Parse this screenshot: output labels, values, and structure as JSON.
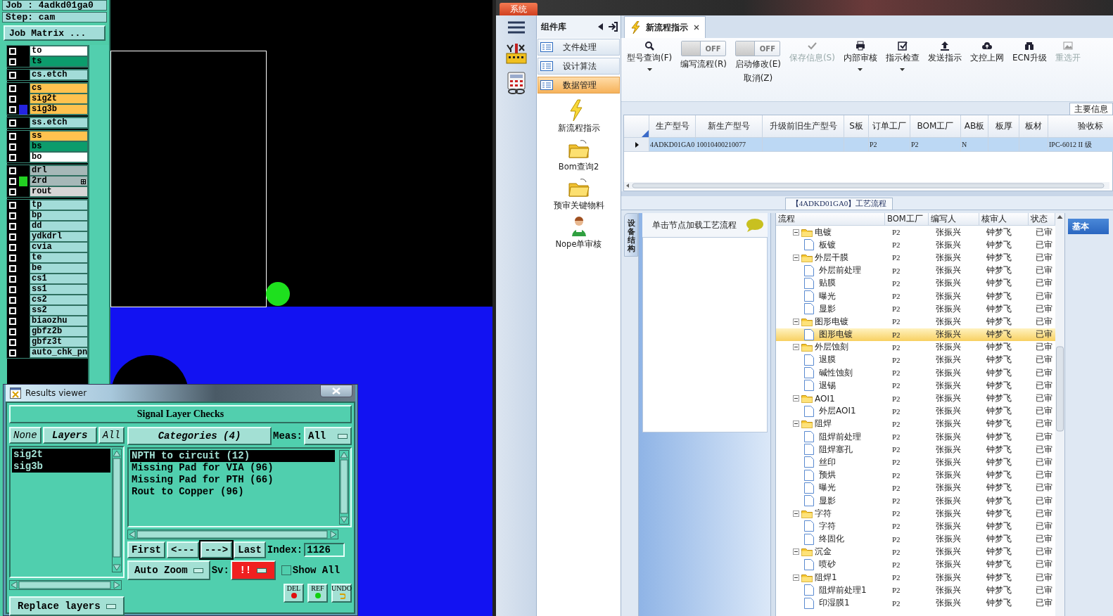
{
  "cam": {
    "job": "Job : 4adkd01ga0",
    "step": "Step: cam",
    "job_matrix_button": "Job Matrix ...",
    "layer_groups": [
      {
        "layers": [
          {
            "name": "to",
            "color": "#ffffff",
            "checked": false
          },
          {
            "name": "ts",
            "color": "#0c9c6c",
            "checked": false
          }
        ]
      },
      {
        "layers": [
          {
            "name": "cs.etch",
            "color": "#a2dcd8",
            "checked": false
          }
        ]
      },
      {
        "layers": [
          {
            "name": "cs",
            "color": "#ffc24f",
            "checked": false
          },
          {
            "name": "sig2t",
            "color": "#ffc24f",
            "checked": false
          },
          {
            "name": "sig3b",
            "color": "#ffc24f",
            "checked": false,
            "swatch": {
              "color": "#2424e0"
            }
          }
        ]
      },
      {
        "layers": [
          {
            "name": "ss.etch",
            "color": "#a2dcd8",
            "checked": false
          }
        ]
      },
      {
        "layers": [
          {
            "name": "ss",
            "color": "#ffc24f",
            "checked": false
          },
          {
            "name": "bs",
            "color": "#0c9c6c",
            "checked": false
          },
          {
            "name": "bo",
            "color": "#ffffff",
            "checked": false
          }
        ]
      },
      {
        "layers": [
          {
            "name": "drl",
            "color": "#a6b8b8",
            "checked": false
          },
          {
            "name": "2rd",
            "color": "#a6b8b8",
            "checked": false,
            "swatch": {
              "color": "#22d022"
            },
            "has_extra": true
          },
          {
            "name": "rout",
            "color": "#d6d6d6",
            "checked": false
          }
        ]
      },
      {
        "layers": [
          {
            "name": "tp",
            "color": "#a2dcd8",
            "checked": false
          },
          {
            "name": "bp",
            "color": "#a2dcd8",
            "checked": false
          },
          {
            "name": "dd",
            "color": "#a2dcd8",
            "checked": false
          },
          {
            "name": "ydkdrl",
            "color": "#a2dcd8",
            "checked": false
          },
          {
            "name": "cvia",
            "color": "#a2dcd8",
            "checked": false
          },
          {
            "name": "te",
            "color": "#a2dcd8",
            "checked": false
          },
          {
            "name": "be",
            "color": "#a2dcd8",
            "checked": false
          },
          {
            "name": "cs1",
            "color": "#a2dcd8",
            "checked": false
          },
          {
            "name": "ss1",
            "color": "#a2dcd8",
            "checked": false
          },
          {
            "name": "cs2",
            "color": "#a2dcd8",
            "checked": false
          },
          {
            "name": "ss2",
            "color": "#a2dcd8",
            "checked": false
          },
          {
            "name": "biaozhu",
            "color": "#a2dcd8",
            "checked": false
          },
          {
            "name": "gbfz2b",
            "color": "#a2dcd8",
            "checked": false
          },
          {
            "name": "gbfz3t",
            "color": "#a2dcd8",
            "checked": false
          },
          {
            "name": "auto_chk_pn",
            "color": "#a2dcd8",
            "checked": false
          }
        ]
      }
    ]
  },
  "results_viewer": {
    "title": "Results viewer",
    "heading": "Signal Layer Checks",
    "layer_buttons": [
      "None",
      "Layers",
      "All"
    ],
    "layers": [
      {
        "name": "sig2t",
        "selected": true
      },
      {
        "name": "sig3b",
        "selected": true
      }
    ],
    "replace_button": "Replace layers",
    "categories_button": "Categories (4)",
    "meas_label": "Meas:",
    "meas_value": "All",
    "categories": [
      {
        "label": "NPTH to circuit (12)",
        "selected": true
      },
      {
        "label": "Missing Pad for VIA (96)",
        "selected": false
      },
      {
        "label": "Missing Pad for PTH (66)",
        "selected": false
      },
      {
        "label": "Rout to Copper (96)",
        "selected": false
      }
    ],
    "nav_buttons": [
      {
        "label": "First",
        "focused": false
      },
      {
        "label": "<---",
        "focused": false
      },
      {
        "label": "--->",
        "focused": true
      },
      {
        "label": "Last",
        "focused": false
      }
    ],
    "index_label": "Index:",
    "index_value": "1126",
    "zoom_mode": "Auto Zoom",
    "sv_label": "Sv:",
    "sv_value": "!!",
    "show_all": {
      "label": "Show All",
      "checked": false
    },
    "tools": [
      {
        "label": "DEL",
        "kind": "delete"
      },
      {
        "label": "REF",
        "kind": "refresh"
      },
      {
        "label": "UNDO",
        "kind": "undo"
      }
    ]
  },
  "erp": {
    "system_tab": "系统",
    "component_header": "组件库",
    "modules": [
      {
        "label": "文件处理",
        "selected": false
      },
      {
        "label": "设计算法",
        "selected": false
      },
      {
        "label": "数据管理",
        "selected": true
      }
    ],
    "launchers": [
      {
        "label": "新流程指示",
        "kind": "bolt"
      },
      {
        "label": "Bom查询2",
        "kind": "folder"
      },
      {
        "label": "预审关键物料",
        "kind": "folder"
      },
      {
        "label": "Nope单审核",
        "kind": "person"
      }
    ],
    "tabs": [
      {
        "label": "新流程指示",
        "selected": true
      }
    ],
    "toolbar": [
      {
        "kind": "button",
        "label": "型号查询(F)",
        "disabled": false,
        "dropdown": true
      },
      {
        "kind": "toggle",
        "state_text": "OFF",
        "on": false,
        "label": "编写流程(R)"
      },
      {
        "kind": "toggle",
        "state_text": "OFF",
        "on": false,
        "label": "启动修改(E)",
        "sublabel": "取消(Z)"
      },
      {
        "kind": "button",
        "label": "保存信息(S)",
        "disabled": true,
        "dropdown": false
      },
      {
        "kind": "button",
        "label": "内部审核",
        "disabled": false,
        "dropdown": true
      },
      {
        "kind": "button",
        "label": "指示检查",
        "disabled": false,
        "dropdown": true
      },
      {
        "kind": "button",
        "label": "发送指示",
        "disabled": false,
        "dropdown": false
      },
      {
        "kind": "button",
        "label": "文控上网",
        "disabled": false,
        "dropdown": false
      },
      {
        "kind": "button",
        "label": "ECN升级",
        "disabled": false,
        "dropdown": false
      },
      {
        "kind": "button",
        "label": "重选开",
        "disabled": true,
        "dropdown": false
      }
    ],
    "info_tab": "主要信息",
    "grid": {
      "columns": [
        "生产型号",
        "新生产型号",
        "升级前旧生产型号",
        "S板",
        "订单工厂",
        "BOM工厂",
        "AB板",
        "板厚",
        "板材",
        "验收标"
      ],
      "rows": [
        {
          "selected": true,
          "cells": [
            "4ADKD01GA0",
            "10010400210077",
            null,
            null,
            "P2",
            "P2",
            "N",
            null,
            null,
            "IPC-6012 II 级"
          ]
        }
      ]
    },
    "process_tab": "【4ADKD01GA0】工艺流程",
    "side_tab": "设备结构",
    "hint": "单击节点加载工艺流程",
    "tree": {
      "columns": [
        "流程",
        "BOM工厂",
        "编写人",
        "核审人",
        "状态"
      ],
      "nodes": [
        {
          "label": "电镀",
          "bom": "P2",
          "writer": "张振兴",
          "reviewer": "钟梦飞",
          "status": "已审",
          "selected": false,
          "expanded": true,
          "children": [
            {
              "label": "板镀",
              "bom": "P2",
              "writer": "张振兴",
              "reviewer": "钟梦飞",
              "status": "已审",
              "selected": false
            }
          ]
        },
        {
          "label": "外层干膜",
          "bom": "P2",
          "writer": "张振兴",
          "reviewer": "钟梦飞",
          "status": "已审",
          "selected": false,
          "expanded": true,
          "children": [
            {
              "label": "外层前处理",
              "bom": "P2",
              "writer": "张振兴",
              "reviewer": "钟梦飞",
              "status": "已审",
              "selected": false
            },
            {
              "label": "贴膜",
              "bom": "P2",
              "writer": "张振兴",
              "reviewer": "钟梦飞",
              "status": "已审",
              "selected": false
            },
            {
              "label": "曝光",
              "bom": "P2",
              "writer": "张振兴",
              "reviewer": "钟梦飞",
              "status": "已审",
              "selected": false
            },
            {
              "label": "显影",
              "bom": "P2",
              "writer": "张振兴",
              "reviewer": "钟梦飞",
              "status": "已审",
              "selected": false
            }
          ]
        },
        {
          "label": "图形电镀",
          "bom": "P2",
          "writer": "张振兴",
          "reviewer": "钟梦飞",
          "status": "已审",
          "selected": false,
          "expanded": true,
          "children": [
            {
              "label": "图形电镀",
              "bom": "P2",
              "writer": "张振兴",
              "reviewer": "钟梦飞",
              "status": "已审",
              "selected": true
            }
          ]
        },
        {
          "label": "外层蚀刻",
          "bom": "P2",
          "writer": "张振兴",
          "reviewer": "钟梦飞",
          "status": "已审",
          "selected": false,
          "expanded": true,
          "children": [
            {
              "label": "退膜",
              "bom": "P2",
              "writer": "张振兴",
              "reviewer": "钟梦飞",
              "status": "已审",
              "selected": false
            },
            {
              "label": "碱性蚀刻",
              "bom": "P2",
              "writer": "张振兴",
              "reviewer": "钟梦飞",
              "status": "已审",
              "selected": false
            },
            {
              "label": "退锡",
              "bom": "P2",
              "writer": "张振兴",
              "reviewer": "钟梦飞",
              "status": "已审",
              "selected": false
            }
          ]
        },
        {
          "label": "AOI1",
          "bom": "P2",
          "writer": "张振兴",
          "reviewer": "钟梦飞",
          "status": "已审",
          "selected": false,
          "expanded": true,
          "children": [
            {
              "label": "外层AOI1",
              "bom": "P2",
              "writer": "张振兴",
              "reviewer": "钟梦飞",
              "status": "已审",
              "selected": false
            }
          ]
        },
        {
          "label": "阻焊",
          "bom": "P2",
          "writer": "张振兴",
          "reviewer": "钟梦飞",
          "status": "已审",
          "selected": false,
          "expanded": true,
          "children": [
            {
              "label": "阻焊前处理",
              "bom": "P2",
              "writer": "张振兴",
              "reviewer": "钟梦飞",
              "status": "已审",
              "selected": false
            },
            {
              "label": "阻焊塞孔",
              "bom": "P2",
              "writer": "张振兴",
              "reviewer": "钟梦飞",
              "status": "已审",
              "selected": false
            },
            {
              "label": "丝印",
              "bom": "P2",
              "writer": "张振兴",
              "reviewer": "钟梦飞",
              "status": "已审",
              "selected": false
            },
            {
              "label": "预烘",
              "bom": "P2",
              "writer": "张振兴",
              "reviewer": "钟梦飞",
              "status": "已审",
              "selected": false
            },
            {
              "label": "曝光",
              "bom": "P2",
              "writer": "张振兴",
              "reviewer": "钟梦飞",
              "status": "已审",
              "selected": false
            },
            {
              "label": "显影",
              "bom": "P2",
              "writer": "张振兴",
              "reviewer": "钟梦飞",
              "status": "已审",
              "selected": false
            }
          ]
        },
        {
          "label": "字符",
          "bom": "P2",
          "writer": "张振兴",
          "reviewer": "钟梦飞",
          "status": "已审",
          "selected": false,
          "expanded": true,
          "children": [
            {
              "label": "字符",
              "bom": "P2",
              "writer": "张振兴",
              "reviewer": "钟梦飞",
              "status": "已审",
              "selected": false
            },
            {
              "label": "终固化",
              "bom": "P2",
              "writer": "张振兴",
              "reviewer": "钟梦飞",
              "status": "已审",
              "selected": false
            }
          ]
        },
        {
          "label": "沉金",
          "bom": "P2",
          "writer": "张振兴",
          "reviewer": "钟梦飞",
          "status": "已审",
          "selected": false,
          "expanded": true,
          "children": [
            {
              "label": "喷砂",
              "bom": "P2",
              "writer": "张振兴",
              "reviewer": "钟梦飞",
              "status": "已审",
              "selected": false
            }
          ]
        },
        {
          "label": "阻焊1",
          "bom": "P2",
          "writer": "张振兴",
          "reviewer": "钟梦飞",
          "status": "已审",
          "selected": false,
          "expanded": true,
          "children": [
            {
              "label": "阻焊前处理1",
              "bom": "P2",
              "writer": "张振兴",
              "reviewer": "钟梦飞",
              "status": "已审",
              "selected": false
            },
            {
              "label": "印湿膜1",
              "bom": "P2",
              "writer": "张振兴",
              "reviewer": "钟梦飞",
              "status": "已审",
              "selected": false
            }
          ]
        }
      ]
    },
    "detail_tab": "基本"
  }
}
